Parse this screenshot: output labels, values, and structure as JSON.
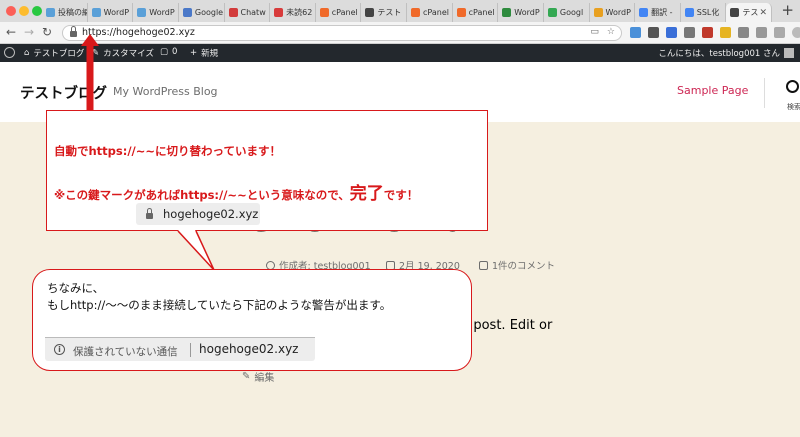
{
  "browser": {
    "tabs": [
      {
        "label": "投稿の編",
        "icon": "wordpress-icon",
        "color": "#5aa0d8"
      },
      {
        "label": "WordP",
        "icon": "wordpress-icon",
        "color": "#5aa0d8"
      },
      {
        "label": "WordP",
        "icon": "wordpress-icon",
        "color": "#5aa0d8"
      },
      {
        "label": "Google",
        "icon": "google-icon",
        "color": "#4a78c8"
      },
      {
        "label": "Chatw",
        "icon": "chatwork-icon",
        "color": "#d23b3b"
      },
      {
        "label": "未読62",
        "icon": "mail-icon",
        "color": "#d83b3b"
      },
      {
        "label": "cPanel",
        "icon": "cpanel-icon",
        "color": "#f06a2a"
      },
      {
        "label": "テスト",
        "icon": "globe-icon",
        "color": "#444444"
      },
      {
        "label": "cPanel",
        "icon": "cpanel-icon",
        "color": "#f06a2a"
      },
      {
        "label": "cPanel",
        "icon": "cpanel-icon",
        "color": "#f06a2a"
      },
      {
        "label": "WordP",
        "icon": "spreadsheet-icon",
        "color": "#2e8b3e"
      },
      {
        "label": "Googl",
        "icon": "google-icon",
        "color": "#34a853"
      },
      {
        "label": "WordP",
        "icon": "bookmark-icon",
        "color": "#e8a020"
      },
      {
        "label": "翻訳 -",
        "icon": "google-icon",
        "color": "#4285f4"
      },
      {
        "label": "SSL化",
        "icon": "google-icon",
        "color": "#4285f4"
      },
      {
        "label": "テス",
        "icon": "globe-icon",
        "color": "#444444",
        "active": true
      }
    ],
    "close_glyph": "✕",
    "new_tab_glyph": "+",
    "url": "https://hogehoge02.xyz",
    "back_glyph": "←",
    "forward_glyph": "→",
    "reload_glyph": "↻"
  },
  "admin_bar": {
    "site_name": "テストブログ",
    "customize": "カスタマイズ",
    "comments_count": "0",
    "new_label": "新規",
    "greeting": "こんにちは、testblog001 さん"
  },
  "site": {
    "title": "テストブログ",
    "description": "My WordPress Blog",
    "nav_sample_page": "Sample Page",
    "search_label": "検索"
  },
  "post": {
    "title": "Hello world!",
    "author": "作成者: testblog001",
    "date": "2月 19, 2020",
    "comments": "1件のコメント",
    "excerpt": "rst post. Edit or",
    "edit_label": "編集"
  },
  "callout1": {
    "line1": "自動でhttps://~~に切り替わっています！",
    "line2_prefix": "※この鍵マークがあればhttps://~~という意味なので、",
    "line2_big": "完了",
    "line2_suffix": "です！",
    "demo_url": "hogehoge02.xyz"
  },
  "callout2": {
    "line1": "ちなみに、",
    "line2": "もしhttp://～～のまま接続していたら下記のような警告が出ます。",
    "warning_text": "保護されていない通信",
    "warning_url": "hogehoge02.xyz",
    "info_glyph": "i"
  },
  "colors": {
    "accent_red": "#d8191b",
    "wp_link": "#cd2653",
    "admin_bar": "#23282d",
    "page_bg": "#f5efe0"
  }
}
